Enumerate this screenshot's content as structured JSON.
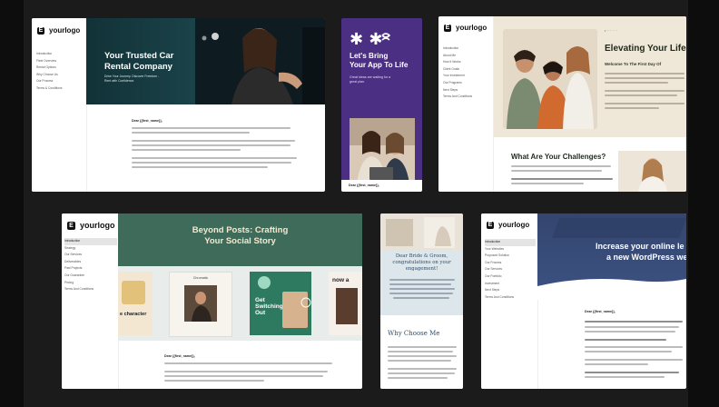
{
  "panel_car": {
    "logo": "yourlogo",
    "logo_mark": "E",
    "title_line1": "Your Trusted Car",
    "title_line2": "Rental Company",
    "subtitle_line1": "Drive Your Journey. Discover Freedom -",
    "subtitle_line2": "Rent with Confidence.",
    "sidebar": [
      "Introduction",
      "Fleet Overview",
      "Rental Options",
      "Why Choose Us",
      "Our Process",
      "Terms & Conditions"
    ],
    "greeting": "Dear {{first_name}},",
    "colors": {
      "hero": "#143a3f",
      "accent_text": "#ffffff"
    }
  },
  "panel_app": {
    "title_line1": "Let's Bring",
    "title_line2": "Your App To Life",
    "subtitle_line1": "Great ideas are waiting for a",
    "subtitle_line2": "great plan.",
    "footer": "Dear {{first_name}},",
    "colors": {
      "bg": "#4b2f83"
    }
  },
  "panel_life": {
    "logo": "yourlogo",
    "logo_mark": "E",
    "title": "Elevating Your Life",
    "welcome": "Welcome To The First Day Of",
    "sidebar": [
      "Introduction",
      "About Me",
      "How It Works",
      "Client Goals",
      "Your Investment",
      "Our Programs",
      "Next Steps",
      "Terms And Conditions"
    ],
    "challenges": "What Are Your Challenges?",
    "colors": {
      "bg": "#efe7d8"
    }
  },
  "panel_social": {
    "logo": "yourlogo",
    "logo_mark": "E",
    "title_line1": "Beyond Posts: Crafting",
    "title_line2": "Your Social Story",
    "sidebar": [
      "Introduction",
      "Strategy",
      "Our Services",
      "Deliverables",
      "Past Projects",
      "Our Guarantee",
      "Pricing",
      "Terms And Conditions"
    ],
    "card_caption_left": "e character",
    "card_caption_mid": "Chromatic",
    "card_caption_green_1": "Get",
    "card_caption_green_2": "Switching",
    "card_caption_green_3": "Out",
    "card_caption_right": "now a",
    "greeting": "Dear {{first_name}},",
    "colors": {
      "hero": "#3f6b5a"
    }
  },
  "panel_wedding": {
    "title_line1": "Dear Bride & Groom,",
    "title_line2": "congratulations on your",
    "title_line3": "engagement!",
    "why": "Why Choose Me",
    "colors": {
      "bg": "#dde6ea",
      "title": "#2f4f6b"
    }
  },
  "panel_wordpress": {
    "logo": "yourlogo",
    "logo_mark": "E",
    "title_line1": "Increase your online le",
    "title_line2": "a new WordPress we",
    "sidebar": [
      "Introduction",
      "Your Websites",
      "Proposed Solution",
      "Our Process",
      "Our Services",
      "Our Portfolio",
      "Investment",
      "Next Steps",
      "Terms And Conditions"
    ],
    "greeting": "Dear {{first_name}},",
    "colors": {
      "hero": "#3a4d79"
    }
  }
}
